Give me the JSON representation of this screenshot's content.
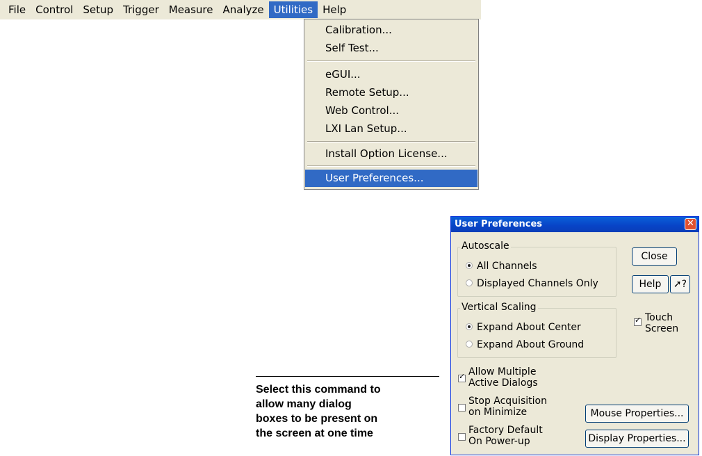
{
  "menubar": {
    "items": [
      {
        "label": "File"
      },
      {
        "label": "Control"
      },
      {
        "label": "Setup"
      },
      {
        "label": "Trigger"
      },
      {
        "label": "Measure"
      },
      {
        "label": "Analyze"
      },
      {
        "label": "Utilities",
        "active": true
      },
      {
        "label": "Help"
      }
    ]
  },
  "utilities_menu": {
    "items": [
      "Calibration...",
      "Self Test...",
      "eGUI...",
      "Remote Setup...",
      "Web Control...",
      "LXI Lan Setup...",
      "Install Option License...",
      "User Preferences..."
    ],
    "selected": "User Preferences..."
  },
  "dialog": {
    "title": "User Preferences",
    "autoscale": {
      "legend": "Autoscale",
      "options": [
        "All Channels",
        "Displayed Channels Only"
      ],
      "selected": "All Channels"
    },
    "vertical_scaling": {
      "legend": "Vertical Scaling",
      "options": [
        "Expand About Center",
        "Expand About Ground"
      ],
      "selected": "Expand About Center"
    },
    "buttons": {
      "close": "Close",
      "help": "Help",
      "whats_this": "?",
      "mouse": "Mouse Properties...",
      "display": "Display Properties..."
    },
    "touch_screen": {
      "line1": "Touch",
      "line2": "Screen",
      "checked": true
    },
    "allow_multiple": {
      "line1": "Allow Multiple",
      "line2": "Active Dialogs",
      "checked": true
    },
    "stop_acquisition": {
      "line1": "Stop Acquisition",
      "line2": "on Minimize",
      "checked": false
    },
    "factory_default": {
      "line1": "Factory Default",
      "line2": "On Power-up",
      "checked": false
    }
  },
  "callout": {
    "lines": [
      "Select this command to",
      "allow many dialog",
      "boxes to be present on",
      "the screen at one time"
    ]
  },
  "colors": {
    "selection": "#316ac5",
    "dialog_face": "#ece9d8",
    "titlebar": "#0a5fd8"
  }
}
